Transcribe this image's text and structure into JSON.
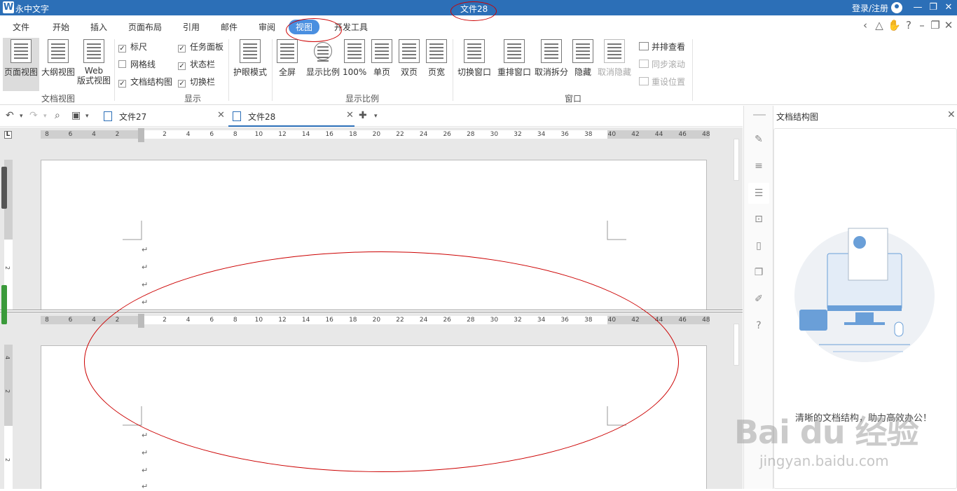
{
  "titlebar": {
    "logo": "W",
    "app_name": "永中文字",
    "doc_title": "文件28",
    "login": "登录/注册",
    "minimize": "—",
    "restore": "❐",
    "close": "✕"
  },
  "menu": {
    "items": [
      "文件",
      "开始",
      "插入",
      "页面布局",
      "引用",
      "邮件",
      "审阅",
      "视图",
      "开发工具"
    ],
    "active": "视图"
  },
  "ribbon": {
    "doc_view": {
      "page_view": "页面视图",
      "outline_view": "大纲视图",
      "web_view_line1": "Web",
      "web_view_line2": "版式视图",
      "group": "文档视图"
    },
    "show": {
      "ruler": "标尺",
      "gridlines": "网格线",
      "doc_map": "文档结构图",
      "task_pane": "任务面板",
      "status_bar": "状态栏",
      "switch_bar": "切换栏",
      "check_mark": "✓",
      "group": "显示"
    },
    "eye_mode": "护眼模式",
    "zoom": {
      "fullscreen": "全屏",
      "zoom": "显示比例",
      "hundred": "100%",
      "single": "单页",
      "double": "双页",
      "width": "页宽",
      "group": "显示比例"
    },
    "window": {
      "switch": "切换窗口",
      "arrange": "重排窗口",
      "unsplit": "取消拆分",
      "hide": "隐藏",
      "unhide": "取消隐藏",
      "side_by_side": "并排查看",
      "sync_scroll": "同步滚动",
      "reset_pos": "重设位置",
      "group": "窗口"
    }
  },
  "tabs": {
    "tab1": "文件27",
    "tab2": "文件28",
    "close": "✕"
  },
  "ruler_labels": [
    "8",
    "6",
    "4",
    "2",
    "2",
    "4",
    "6",
    "8",
    "10",
    "12",
    "14",
    "16",
    "18",
    "20",
    "22",
    "24",
    "26",
    "28",
    "30",
    "32",
    "34",
    "36",
    "38",
    "40",
    "42",
    "44",
    "46",
    "48"
  ],
  "vruler_labels_top": [
    "2"
  ],
  "vruler_labels_bottom": [
    "4",
    "2",
    "2"
  ],
  "ruler_corner": "L",
  "paragraph_mark": "↵",
  "panel": {
    "title": "文档结构图",
    "close": "✕",
    "message": "清晰的文档结构，助力高效办公！"
  },
  "watermark": {
    "line1": "Bai du 经验",
    "line2": "jingyan.baidu.com"
  }
}
